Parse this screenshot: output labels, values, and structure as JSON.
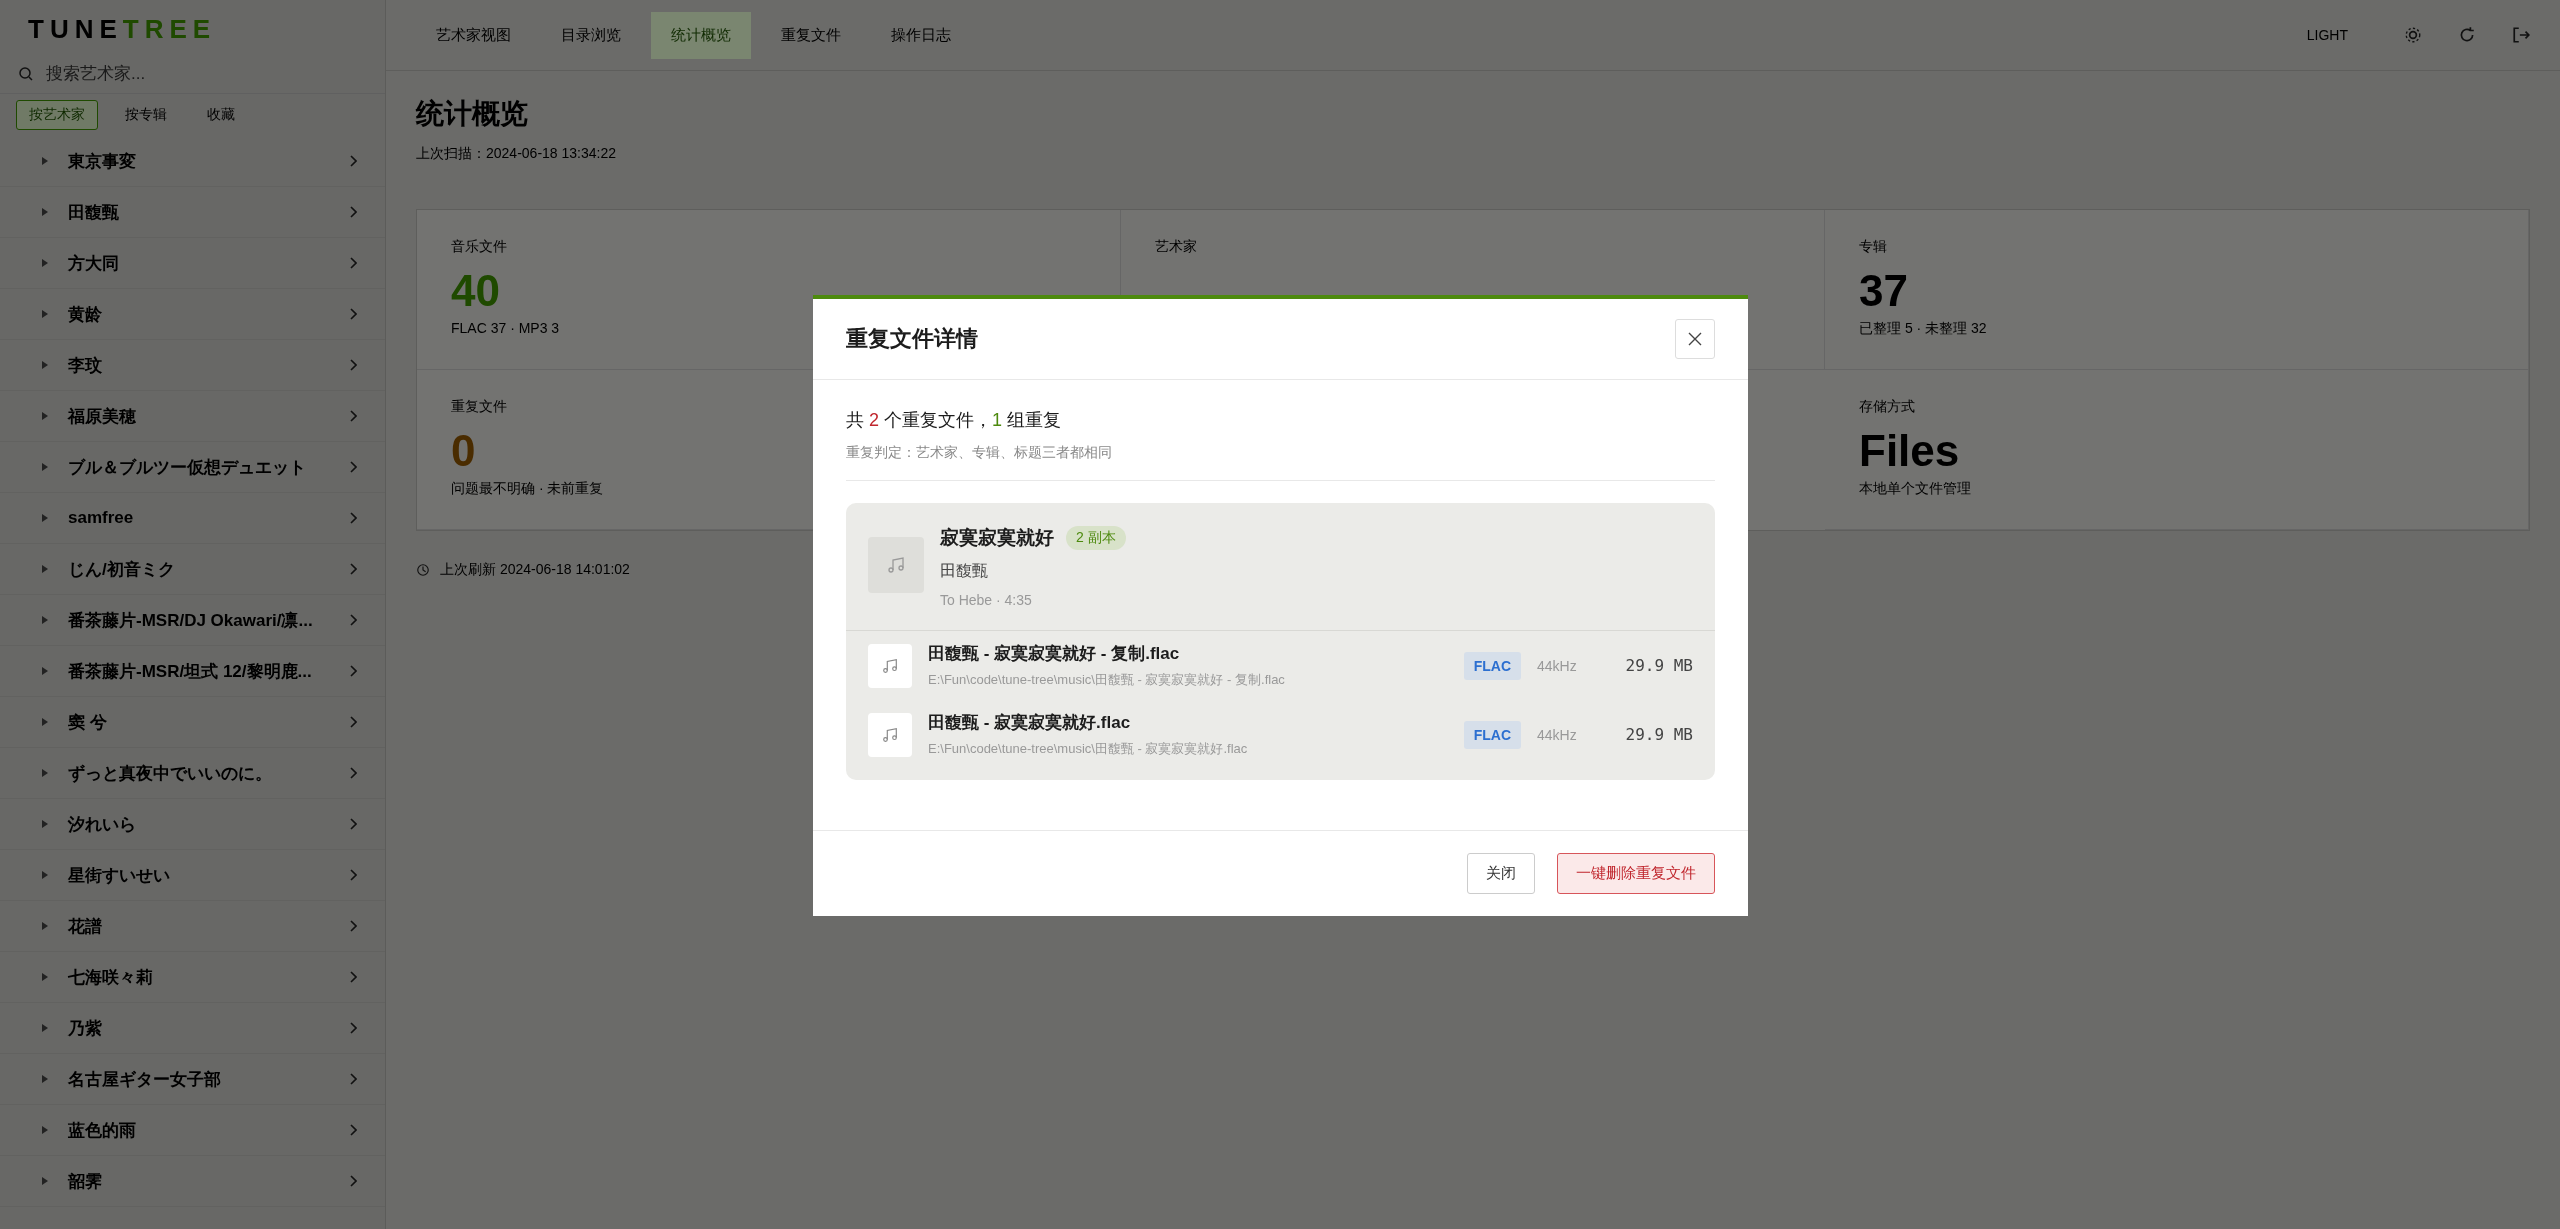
{
  "logo": {
    "parts": [
      {
        "text": "TUNE",
        "accent": false
      },
      {
        "text": "TREE",
        "accent": true
      }
    ]
  },
  "sidebar": {
    "search": {
      "placeholder": "搜索艺术家..."
    },
    "filters": [
      {
        "label": "按艺术家",
        "selected": true
      },
      {
        "label": "按专辑",
        "selected": false
      },
      {
        "label": "收藏",
        "selected": false
      }
    ],
    "artists": [
      {
        "name": "東京事変"
      },
      {
        "name": "田馥甄"
      },
      {
        "name": "方大同"
      },
      {
        "name": "黄龄"
      },
      {
        "name": "李玟"
      },
      {
        "name": "福原美穂"
      },
      {
        "name": "ブル＆ブルツー仮想デュエット"
      },
      {
        "name": "samfree"
      },
      {
        "name": "じん/初音ミク"
      },
      {
        "name": "番茶藤片-MSR/DJ Okawari/凛..."
      },
      {
        "name": "番茶藤片-MSR/坦式 12/黎明鹿..."
      },
      {
        "name": "窦 兮"
      },
      {
        "name": "ずっと真夜中でいいのに。"
      },
      {
        "name": "汐れいら"
      },
      {
        "name": "星街すいせい"
      },
      {
        "name": "花譜"
      },
      {
        "name": "七海咲々莉"
      },
      {
        "name": "乃紫"
      },
      {
        "name": "名古屋ギター女子部"
      },
      {
        "name": "蓝色的雨"
      },
      {
        "name": "韶霁"
      }
    ]
  },
  "nav": {
    "tabs": [
      {
        "label": "艺术家视图",
        "selected": false
      },
      {
        "label": "目录浏览",
        "selected": false
      },
      {
        "label": "统计概览",
        "selected": true
      },
      {
        "label": "重复文件",
        "selected": false
      },
      {
        "label": "操作日志",
        "selected": false
      }
    ],
    "theme_label": "LIGHT"
  },
  "page": {
    "title": "统计概览",
    "subtitle": "上次扫描：2024-06-18 13:34:22",
    "stats": [
      {
        "label": "音乐文件",
        "value": "40",
        "detail": "FLAC 37 · MP3 3",
        "color": "#1f4a00"
      },
      {
        "label": "艺术家"
      },
      {
        "label": "专辑",
        "value": "37",
        "detail": "已整理 5 · 未整理 32",
        "color": "#000000"
      },
      {
        "label": "重复文件",
        "value": "0",
        "detail": "问题最不明确 · 未前重复",
        "color": "#4a2c00"
      },
      {
        "label": "存储方式",
        "value": "Files",
        "detail": "本地单个文件管理",
        "color": "#000000"
      }
    ],
    "footer_note": "上次刷新 2024-06-18 14:01:02"
  },
  "dialog": {
    "title": "重复文件详情",
    "summary": [
      {
        "text": "共 ",
        "kind": "plain"
      },
      {
        "text": "2",
        "kind": "danger"
      },
      {
        "text": " 个重复文件，",
        "kind": "plain"
      },
      {
        "text": "1",
        "kind": "success"
      },
      {
        "text": " 组重复",
        "kind": "plain"
      }
    ],
    "criteria": "重复判定：艺术家、专辑、标题三者都相同",
    "groups": [
      {
        "title": "寂寞寂寞就好",
        "badge": "2 副本",
        "artist": "田馥甄",
        "meta": "To Hebe · 4:35",
        "files": [
          {
            "name": "田馥甄 - 寂寞寂寞就好 - 复制.flac",
            "path": "E:\\Fun\\code\\tune-tree\\music\\田馥甄 - 寂寞寂寞就好 - 复制.flac",
            "format": "FLAC",
            "rate": "44kHz",
            "size": "29.9 MB"
          },
          {
            "name": "田馥甄 - 寂寞寂寞就好.flac",
            "path": "E:\\Fun\\code\\tune-tree\\music\\田馥甄 - 寂寞寂寞就好.flac",
            "format": "FLAC",
            "rate": "44kHz",
            "size": "29.9 MB"
          }
        ]
      }
    ],
    "buttons": [
      {
        "label": "关闭",
        "kind": "secondary"
      },
      {
        "label": "一键删除重复文件",
        "kind": "danger"
      }
    ]
  }
}
